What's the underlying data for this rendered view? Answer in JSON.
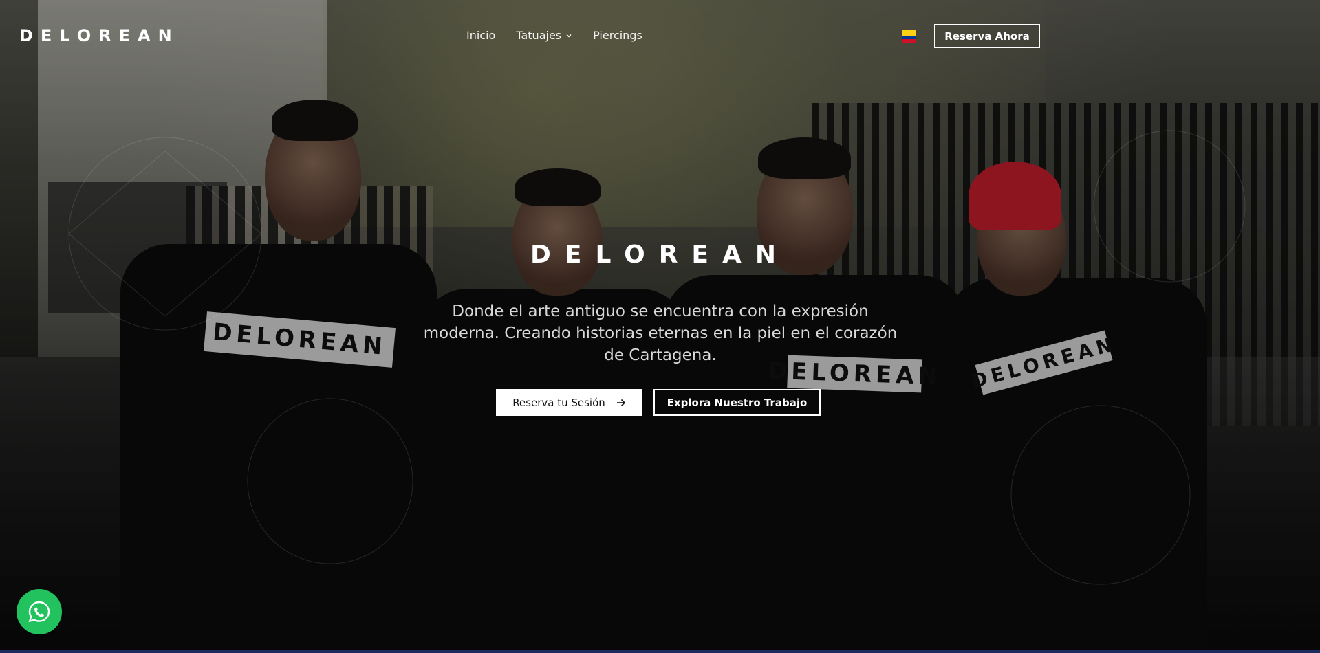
{
  "header": {
    "logo": "DELOREAN",
    "nav": [
      {
        "label": "Inicio"
      },
      {
        "label": "Tatuajes",
        "has_dropdown": true
      },
      {
        "label": "Piercings"
      }
    ],
    "language_flag": "colombia-flag",
    "cta_label": "Reserva Ahora"
  },
  "hero": {
    "title": "DELOREAN",
    "subtitle": "Donde el arte antiguo se encuentra con la expresión moderna. Creando historias eternas en la piel en el corazón de Cartagena.",
    "primary_button": {
      "label": "Reserva tu Sesión",
      "icon": "arrow-right-icon"
    },
    "secondary_button": {
      "label": "Explora Nuestro Trabajo"
    },
    "shirt_print": "DELOREAN"
  },
  "floating": {
    "whatsapp_icon": "whatsapp-icon"
  },
  "colors": {
    "accent_whatsapp": "#22c35e",
    "bottom_bar": "#1d2b5e",
    "flag_yellow": "#fcd116",
    "flag_blue": "#003893",
    "flag_red": "#ce1126"
  }
}
